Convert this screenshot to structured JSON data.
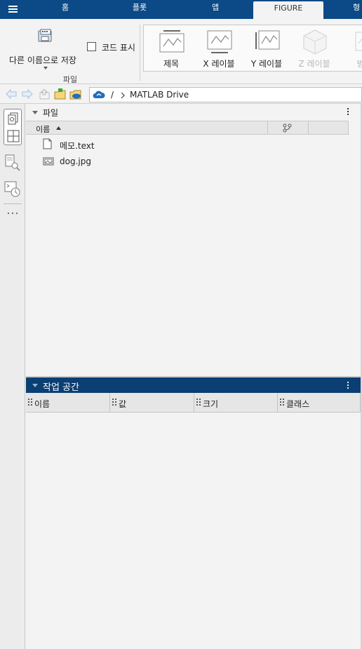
{
  "tabs": [
    {
      "label": "홈"
    },
    {
      "label": "플롯"
    },
    {
      "label": "앱"
    },
    {
      "label": "FIGURE"
    },
    {
      "label": "형"
    }
  ],
  "ribbon": {
    "save_as_label": "다른 이름으로 저장",
    "show_code_label": "코드 표시",
    "file_group_label": "파일",
    "label_buttons": [
      {
        "label": "제목",
        "icon": "title-icon",
        "enabled": true
      },
      {
        "label": "X 레이블",
        "icon": "xlabel-icon",
        "enabled": true
      },
      {
        "label": "Y 레이블",
        "icon": "ylabel-icon",
        "enabled": true
      },
      {
        "label": "Z 레이블",
        "icon": "zlabel-icon",
        "enabled": false
      },
      {
        "label": "범",
        "icon": "legend-icon",
        "enabled": false
      }
    ]
  },
  "address": {
    "root": "/",
    "folder": "MATLAB Drive"
  },
  "files_panel": {
    "title": "파일",
    "column_name": "이름",
    "files": [
      {
        "name": "메모.text",
        "icon": "text-file-icon"
      },
      {
        "name": "dog.jpg",
        "icon": "image-file-icon"
      }
    ]
  },
  "workspace_panel": {
    "title": "작업 공간",
    "columns": [
      "이름",
      "값",
      "크기",
      "클래스"
    ]
  },
  "colors": {
    "tabbar": "#0b4a86",
    "workspace_header": "#0b3f73",
    "cloud_accent": "#1f6fbf"
  }
}
